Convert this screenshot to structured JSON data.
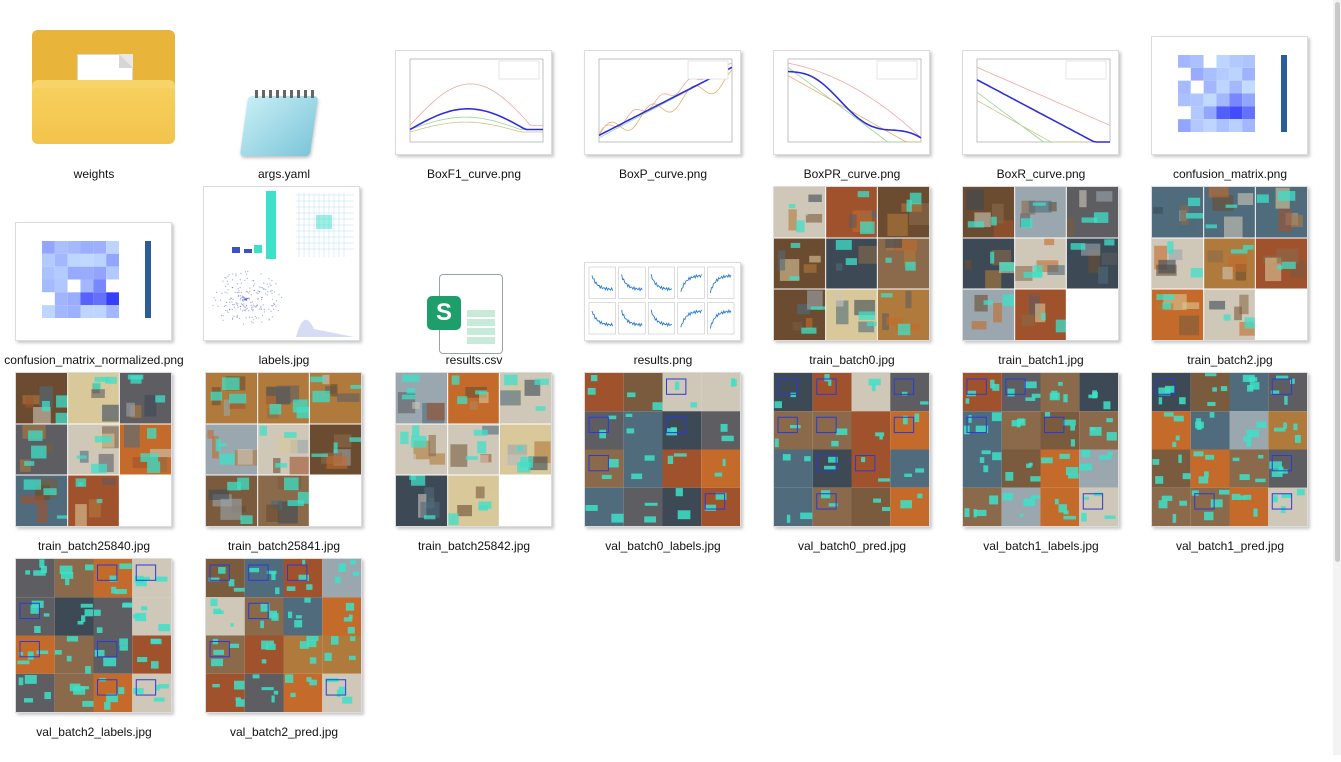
{
  "files": [
    {
      "name": "weights",
      "type": "folder",
      "icon": "folder-icon"
    },
    {
      "name": "args.yaml",
      "type": "yaml",
      "icon": "notepad-icon"
    },
    {
      "name": "BoxF1_curve.png",
      "type": "image",
      "icon": "line-chart-thumbnail"
    },
    {
      "name": "BoxP_curve.png",
      "type": "image",
      "icon": "line-chart-thumbnail"
    },
    {
      "name": "BoxPR_curve.png",
      "type": "image",
      "icon": "line-chart-thumbnail"
    },
    {
      "name": "BoxR_curve.png",
      "type": "image",
      "icon": "line-chart-thumbnail"
    },
    {
      "name": "confusion_matrix.png",
      "type": "image",
      "icon": "heatmap-thumbnail"
    },
    {
      "name": "confusion_matrix_normalized.png",
      "type": "image",
      "icon": "heatmap-thumbnail"
    },
    {
      "name": "labels.jpg",
      "type": "image",
      "icon": "labels-plot-thumbnail"
    },
    {
      "name": "results.csv",
      "type": "csv",
      "icon": "spreadsheet-icon"
    },
    {
      "name": "results.png",
      "type": "image",
      "icon": "results-grid-thumbnail"
    },
    {
      "name": "train_batch0.jpg",
      "type": "image",
      "icon": "photo-mosaic-thumbnail"
    },
    {
      "name": "train_batch1.jpg",
      "type": "image",
      "icon": "photo-mosaic-thumbnail"
    },
    {
      "name": "train_batch2.jpg",
      "type": "image",
      "icon": "photo-mosaic-thumbnail"
    },
    {
      "name": "train_batch25840.jpg",
      "type": "image",
      "icon": "photo-mosaic-thumbnail"
    },
    {
      "name": "train_batch25841.jpg",
      "type": "image",
      "icon": "photo-mosaic-thumbnail"
    },
    {
      "name": "train_batch25842.jpg",
      "type": "image",
      "icon": "photo-mosaic-thumbnail"
    },
    {
      "name": "val_batch0_labels.jpg",
      "type": "image",
      "icon": "photo-mosaic-thumbnail"
    },
    {
      "name": "val_batch0_pred.jpg",
      "type": "image",
      "icon": "photo-mosaic-thumbnail"
    },
    {
      "name": "val_batch1_labels.jpg",
      "type": "image",
      "icon": "photo-mosaic-thumbnail"
    },
    {
      "name": "val_batch1_pred.jpg",
      "type": "image",
      "icon": "photo-mosaic-thumbnail"
    },
    {
      "name": "val_batch2_labels.jpg",
      "type": "image",
      "icon": "photo-mosaic-thumbnail"
    },
    {
      "name": "val_batch2_pred.jpg",
      "type": "image",
      "icon": "photo-mosaic-thumbnail"
    }
  ],
  "colors": {
    "folder": "#f2c44b",
    "csv_badge": "#1e9e6a",
    "detection_box": "#3de0c8"
  }
}
